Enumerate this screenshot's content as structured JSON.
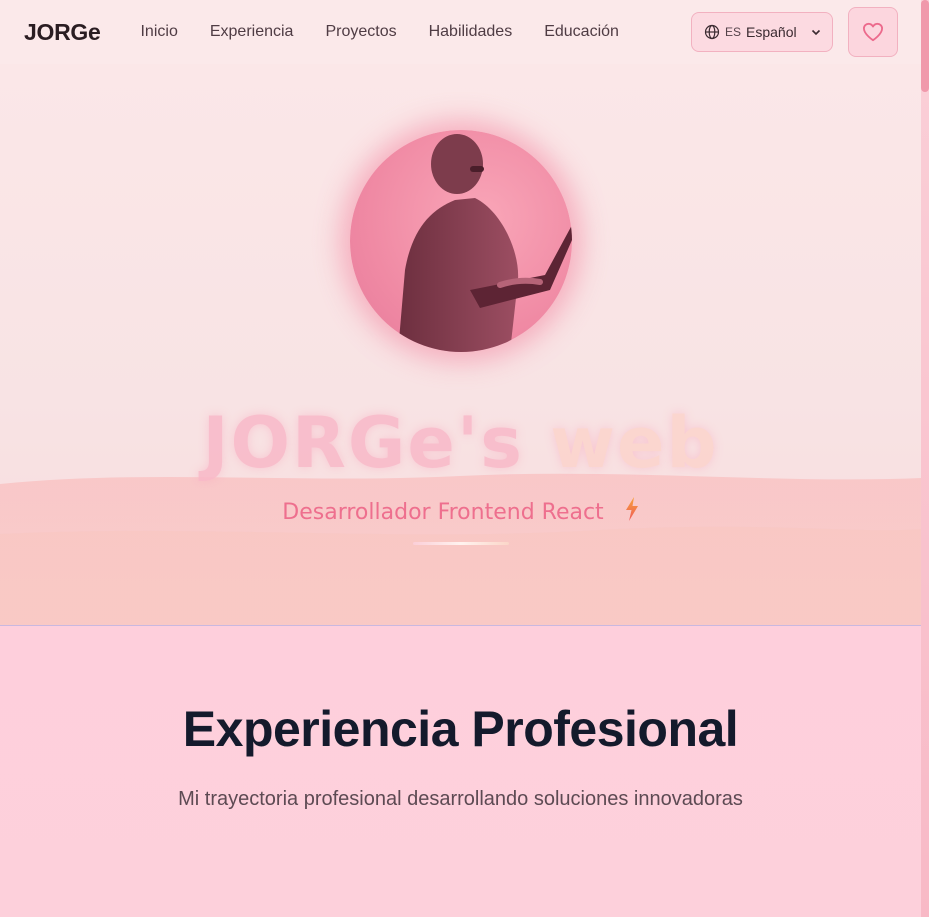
{
  "header": {
    "brand": "JORGe",
    "nav": [
      "Inicio",
      "Experiencia",
      "Proyectos",
      "Habilidades",
      "Educación"
    ],
    "language": {
      "code": "ES",
      "name": "Español",
      "icon": "globe-icon"
    },
    "favorite_icon": "heart-icon"
  },
  "hero": {
    "avatar_alt": "profile-photo",
    "title_main": "JORGe's",
    "title_accent": "web",
    "subtitle": "Desarrollador Frontend React",
    "subtitle_icon": "lightning-icon"
  },
  "section": {
    "title": "Experiencia Profesional",
    "subtitle": "Mi trayectoria profesional desarrollando soluciones innovadoras"
  },
  "colors": {
    "accent": "#ee6f8e",
    "background": "#fbe9ea",
    "section_background": "#fecfdc",
    "heading": "#141a2c"
  }
}
